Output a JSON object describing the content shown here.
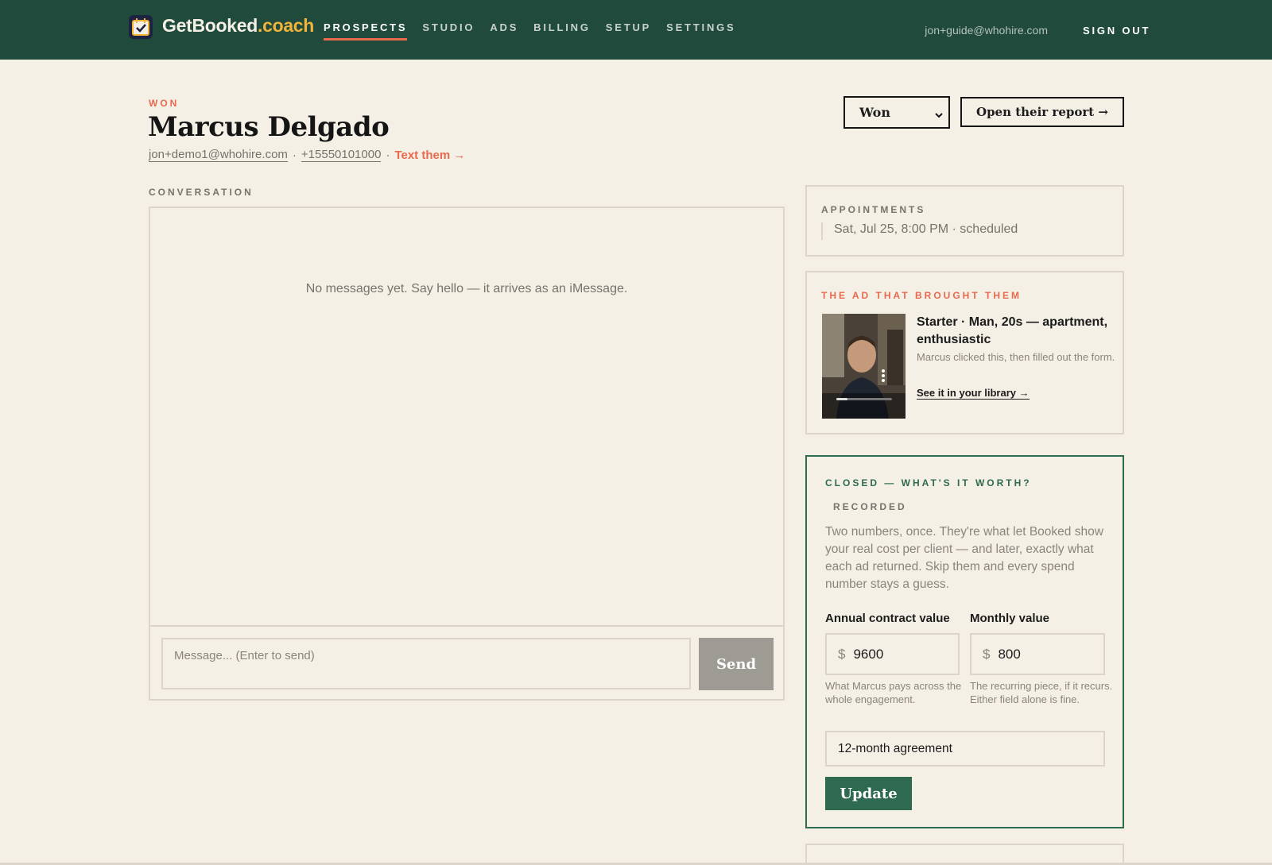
{
  "brand": {
    "name": "GetBooked",
    "suffix": ".coach",
    "accent_color": "#f0b43a",
    "nav_bg": "#1f4a3c"
  },
  "nav": {
    "items": [
      {
        "label": "PROSPECTS",
        "active": true
      },
      {
        "label": "STUDIO",
        "active": false
      },
      {
        "label": "ADS",
        "active": false
      },
      {
        "label": "BILLING",
        "active": false
      },
      {
        "label": "SETUP",
        "active": false
      },
      {
        "label": "SETTINGS",
        "active": false
      }
    ],
    "user_email": "jon+guide@whohire.com",
    "sign_out": "SIGN OUT"
  },
  "prospect": {
    "status_tag": "WON",
    "name": "Marcus Delgado",
    "email": "jon+demo1@whohire.com",
    "phone": "+15550101000",
    "separator": "·",
    "text_action": "Text them →",
    "status_select": {
      "value": "Won",
      "icon": "chevron-down-icon"
    },
    "open_report": "Open their report →"
  },
  "conversation": {
    "label": "CONVERSATION",
    "empty_text": "No messages yet. Say hello — it arrives as an iMessage.",
    "input_placeholder": "Message... (Enter to send)",
    "send_label": "Send"
  },
  "appointments": {
    "label": "APPOINTMENTS",
    "items": [
      "Sat, Jul 25, 8:00 PM · scheduled"
    ]
  },
  "ad": {
    "label": "THE AD THAT BROUGHT THEM",
    "title": "Starter · Man, 20s — apartment, enthusiastic",
    "description": "Marcus clicked this, then filled out the form.",
    "link": "See it in your library →",
    "label_color": "#e8694e"
  },
  "worth": {
    "label": "CLOSED — WHAT'S IT WORTH?",
    "badge": "RECORDED",
    "description": "Two numbers, once. They're what let Booked show your real cost per client — and later, exactly what each ad returned. Skip them and every spend number stays a guess.",
    "annual_label": "Annual contract value",
    "annual_value": "9600",
    "annual_help": "What Marcus pays across the whole engagement.",
    "monthly_label": "Monthly value",
    "monthly_value": "800",
    "monthly_help": "The recurring piece, if it recurs. Either field alone is fine.",
    "currency": "$",
    "term_value": "12-month agreement",
    "update_label": "Update",
    "accent_color": "#2d6a50"
  }
}
